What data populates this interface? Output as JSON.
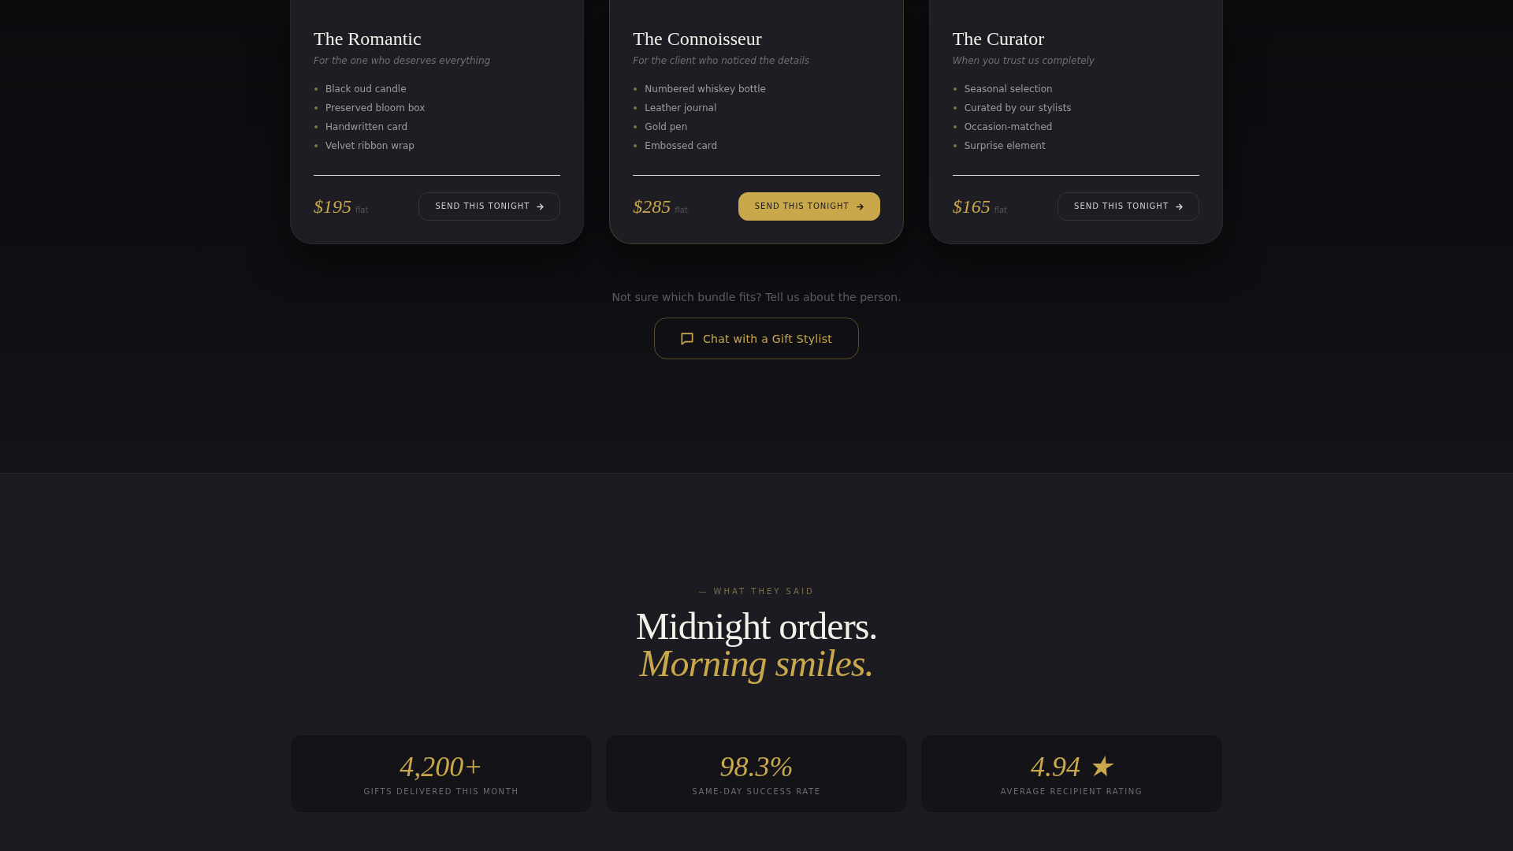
{
  "bundles": [
    {
      "title": "The Romantic",
      "tagline": "For the one who deserves everything",
      "items": [
        "Black oud candle",
        "Preserved bloom box",
        "Handwritten card",
        "Velvet ribbon wrap"
      ],
      "price": "$195",
      "price_note": "flat",
      "button": "SEND THIS TONIGHT",
      "featured": false
    },
    {
      "title": "The Connoisseur",
      "tagline": "For the client who noticed the details",
      "items": [
        "Numbered whiskey bottle",
        "Leather journal",
        "Gold pen",
        "Embossed card"
      ],
      "price": "$285",
      "price_note": "flat",
      "button": "SEND THIS TONIGHT",
      "featured": true
    },
    {
      "title": "The Curator",
      "tagline": "When you trust us completely",
      "items": [
        "Seasonal selection",
        "Curated by our stylists",
        "Occasion-matched",
        "Surprise element"
      ],
      "price": "$165",
      "price_note": "flat",
      "button": "SEND THIS TONIGHT",
      "featured": false
    }
  ],
  "help": {
    "text": "Not sure which bundle fits? Tell us about the person.",
    "button": "Chat with a Gift Stylist"
  },
  "testimonials": {
    "eyebrow": "— WHAT THEY SAID",
    "heading": "Midnight orders. *Morning smiles.*",
    "stats": [
      {
        "value": "4,200+",
        "label": "GIFTS DELIVERED THIS MONTH"
      },
      {
        "value": "98.3%",
        "label": "SAME-DAY SUCCESS RATE"
      },
      {
        "value": "4.94 ★",
        "label": "AVERAGE RECIPIENT RATING"
      }
    ]
  }
}
